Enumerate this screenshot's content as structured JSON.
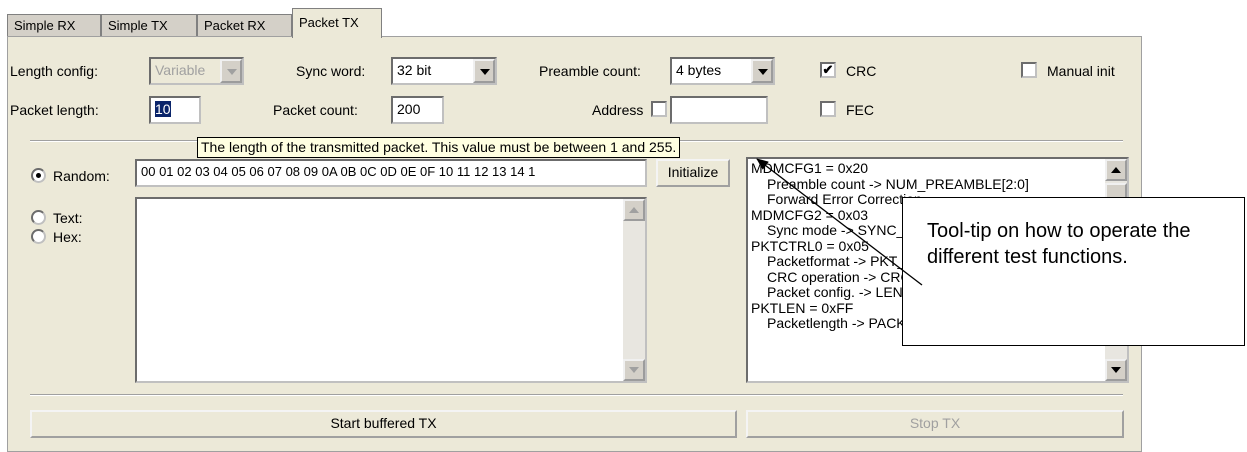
{
  "tabs": [
    {
      "label": "Simple RX",
      "active": false
    },
    {
      "label": "Simple TX",
      "active": false
    },
    {
      "label": "Packet RX",
      "active": false
    },
    {
      "label": "Packet TX",
      "active": true
    }
  ],
  "settings": {
    "length_config_label": "Length config:",
    "length_config_value": "Variable",
    "sync_word_label": "Sync word:",
    "sync_word_value": "32 bit",
    "preamble_count_label": "Preamble count:",
    "preamble_count_value": "4 bytes",
    "crc_label": "CRC",
    "crc_checked": true,
    "manual_init_label": "Manual init",
    "manual_init_checked": false,
    "packet_length_label": "Packet length:",
    "packet_length_value": "10",
    "packet_count_label": "Packet count:",
    "packet_count_value": "200",
    "address_label": "Address",
    "address_checked": false,
    "address_value": "",
    "fec_label": "FEC",
    "fec_checked": false
  },
  "data_source": {
    "random_label": "Random:",
    "random_selected": true,
    "random_data": "00 01 02 03 04 05 06 07 08 09 0A 0B 0C 0D 0E 0F 10 11 12 13 14 1",
    "initialize_label": "Initialize",
    "text_label": "Text:",
    "hex_label": "Hex:",
    "payload_text": ""
  },
  "registers": [
    {
      "text": "MDMCFG1 = 0x20",
      "indent": false
    },
    {
      "text": "Preamble count -> NUM_PREAMBLE[2:0]",
      "indent": true
    },
    {
      "text": "Forward Error Correction",
      "indent": true
    },
    {
      "text": "MDMCFG2 = 0x03",
      "indent": false
    },
    {
      "text": "Sync mode -> SYNC_MODE[2:0]",
      "indent": true
    },
    {
      "text": "PKTCTRL0 = 0x05",
      "indent": false
    },
    {
      "text": "Packetformat -> PKT_FORMAT[1:0]",
      "indent": true
    },
    {
      "text": "CRC operation -> CRC_EN",
      "indent": true
    },
    {
      "text": "Packet config. -> LENGTH_CONFIG[1:0]",
      "indent": true
    },
    {
      "text": "PKTLEN = 0xFF",
      "indent": false
    },
    {
      "text": "Packetlength -> PACKET_LENGTH[7:0]",
      "indent": true
    }
  ],
  "actions": {
    "start_label": "Start buffered TX",
    "stop_label": "Stop TX"
  },
  "tooltip_text": "The length of the transmitted packet. This value must be between 1 and 255.",
  "callout_text": "Tool-tip on how to operate the different test functions."
}
